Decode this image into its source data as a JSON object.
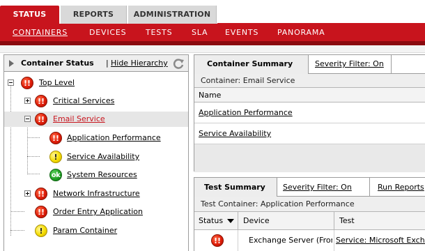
{
  "top_tabs": [
    {
      "label": "STATUS",
      "active": true
    },
    {
      "label": "REPORTS",
      "active": false
    },
    {
      "label": "ADMINISTRATION",
      "active": false
    }
  ],
  "sub_nav": [
    {
      "label": "CONTAINERS",
      "selected": true
    },
    {
      "label": "DEVICES",
      "selected": false
    },
    {
      "label": "TESTS",
      "selected": false
    },
    {
      "label": "SLA",
      "selected": false
    },
    {
      "label": "EVENTS",
      "selected": false
    },
    {
      "label": "PANORAMA",
      "selected": false
    }
  ],
  "left_panel": {
    "title": "Container Status",
    "separator": "|",
    "hide_link": "Hide Hierarchy",
    "tree": [
      {
        "label": "Top Level",
        "status": "critical",
        "status_glyph": "!!",
        "expander": "minus",
        "level": 0
      },
      {
        "label": "Critical Services",
        "status": "critical",
        "status_glyph": "!!",
        "expander": "plus",
        "level": 1
      },
      {
        "label": "Email Service",
        "status": "critical",
        "status_glyph": "!!",
        "expander": "minus",
        "level": 1,
        "selected": true
      },
      {
        "label": "Application Performance",
        "status": "critical",
        "status_glyph": "!!",
        "level": 2
      },
      {
        "label": "Service Availability",
        "status": "warning",
        "status_glyph": "!",
        "level": 2
      },
      {
        "label": "System Resources",
        "status": "ok",
        "status_glyph": "ok",
        "level": 2
      },
      {
        "label": "Network Infrastructure",
        "status": "critical",
        "status_glyph": "!!",
        "expander": "plus",
        "level": 1
      },
      {
        "label": "Order Entry Application",
        "status": "critical",
        "status_glyph": "!!",
        "level": 1
      },
      {
        "label": "Param Container",
        "status": "warning",
        "status_glyph": "!",
        "level": 1
      }
    ]
  },
  "container_summary": {
    "tab_label": "Container Summary",
    "severity_filter": "Severity Filter: On",
    "subtitle": "Container: Email Service",
    "column_header": "Name",
    "rows": [
      "Application Performance",
      "Service Availability"
    ]
  },
  "test_summary": {
    "tab_label": "Test Summary",
    "severity_filter": "Severity Filter: On",
    "run_reports": "Run Reports",
    "subtitle": "Test Container: Application Performance",
    "columns": [
      "Status",
      "Device",
      "Test"
    ],
    "rows": [
      {
        "status": "critical",
        "status_glyph": "!!",
        "device": "Exchange Server (Front End)",
        "test": "Service: Microsoft Exchange"
      }
    ]
  },
  "colors": {
    "brand_red": "#c8141d",
    "critical": "#e01e0a",
    "warning": "#f5dd00",
    "ok": "#1e9d22"
  }
}
